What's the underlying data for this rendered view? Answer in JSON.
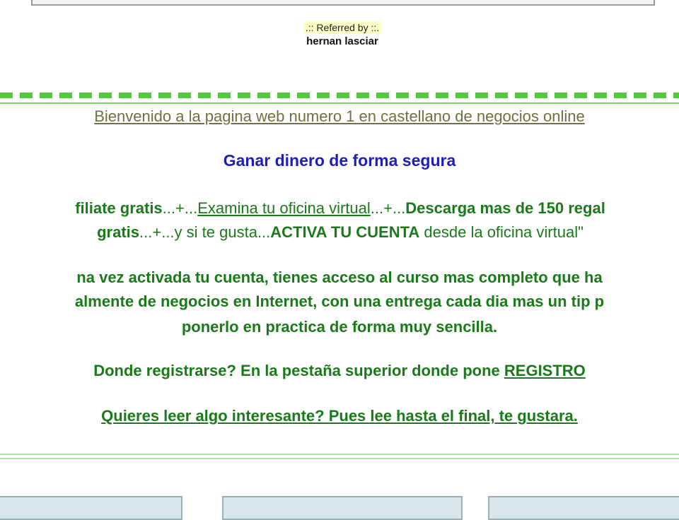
{
  "referral": {
    "label": ".:: Referred by ::.",
    "name": "hernan lasciar"
  },
  "welcome": "Bienvenido a la pagina web numero 1 en castellano de negocios online",
  "subtitle": "Ganar dinero de forma segura",
  "steps_line1": {
    "a": "filiate gratis",
    "b": "...+...",
    "c": "Examina tu oficina virtual",
    "d": "...+...",
    "e": "Descarga mas de 150 regal"
  },
  "steps_line2": {
    "a": "gratis",
    "b": "...+...y si te gusta...",
    "c": "ACTIVA TU CUENTA",
    "d": " desde la oficina virtual\""
  },
  "paragraph": {
    "line1": "na vez activada tu cuenta, tienes acceso al curso mas completo que ha",
    "line2": "almente de negocios en Internet, con una entrega cada dia mas un tip p",
    "line3": "ponerlo en practica de forma muy sencilla."
  },
  "register": {
    "text": "Donde registrarse? En la pestaña superior donde pone ",
    "link": "REGISTRO"
  },
  "read_more": "Quieres leer algo interesante? Pues lee hasta el final, te gustara.",
  "colors": {
    "green_text": "#1a7a1a",
    "blue_text": "#1d1db8",
    "olive_link": "#707040",
    "dashed_green": "#55c83c"
  }
}
